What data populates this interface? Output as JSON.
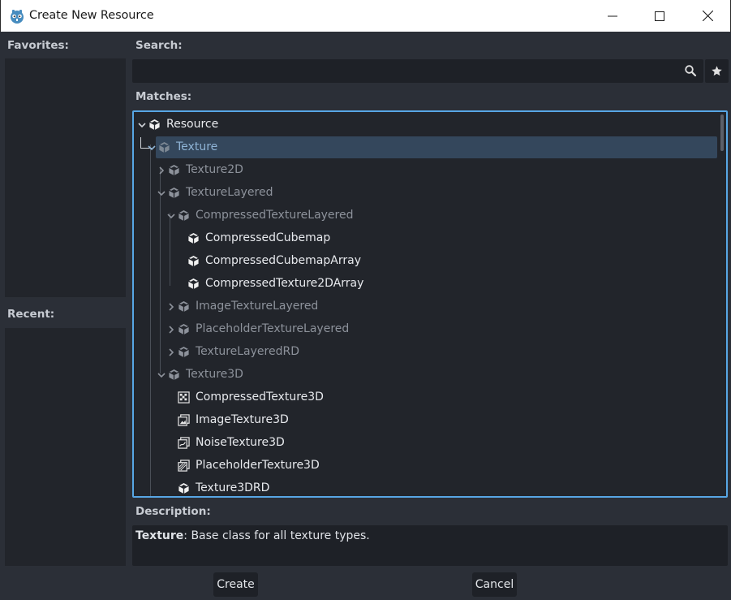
{
  "window": {
    "title": "Create New Resource"
  },
  "labels": {
    "favorites": "Favorites:",
    "recent": "Recent:",
    "search": "Search:",
    "matches": "Matches:",
    "description": "Description:"
  },
  "search": {
    "value": "",
    "placeholder": ""
  },
  "tree": [
    {
      "label": "Resource",
      "depth": 0,
      "expanded": true,
      "dim": false,
      "selected": false
    },
    {
      "label": "Texture",
      "depth": 1,
      "expanded": true,
      "dim": true,
      "selected": true
    },
    {
      "label": "Texture2D",
      "depth": 2,
      "expanded": false,
      "dim": true,
      "selected": false
    },
    {
      "label": "TextureLayered",
      "depth": 2,
      "expanded": true,
      "dim": true,
      "selected": false
    },
    {
      "label": "CompressedTextureLayered",
      "depth": 3,
      "expanded": true,
      "dim": true,
      "selected": false
    },
    {
      "label": "CompressedCubemap",
      "depth": 4,
      "expanded": null,
      "dim": false,
      "selected": false
    },
    {
      "label": "CompressedCubemapArray",
      "depth": 4,
      "expanded": null,
      "dim": false,
      "selected": false
    },
    {
      "label": "CompressedTexture2DArray",
      "depth": 4,
      "expanded": null,
      "dim": false,
      "selected": false
    },
    {
      "label": "ImageTextureLayered",
      "depth": 3,
      "expanded": false,
      "dim": true,
      "selected": false
    },
    {
      "label": "PlaceholderTextureLayered",
      "depth": 3,
      "expanded": false,
      "dim": true,
      "selected": false
    },
    {
      "label": "TextureLayeredRD",
      "depth": 3,
      "expanded": false,
      "dim": true,
      "selected": false
    },
    {
      "label": "Texture3D",
      "depth": 2,
      "expanded": true,
      "dim": true,
      "selected": false
    },
    {
      "label": "CompressedTexture3D",
      "depth": 3,
      "expanded": null,
      "dim": false,
      "selected": false,
      "icon": "compressed-texture-icon"
    },
    {
      "label": "ImageTexture3D",
      "depth": 3,
      "expanded": null,
      "dim": false,
      "selected": false,
      "icon": "image-texture-icon"
    },
    {
      "label": "NoiseTexture3D",
      "depth": 3,
      "expanded": null,
      "dim": false,
      "selected": false,
      "icon": "noise-texture-icon"
    },
    {
      "label": "PlaceholderTexture3D",
      "depth": 3,
      "expanded": null,
      "dim": false,
      "selected": false,
      "icon": "placeholder-texture-icon"
    },
    {
      "label": "Texture3DRD",
      "depth": 3,
      "expanded": null,
      "dim": false,
      "selected": false
    }
  ],
  "description": {
    "class_name": "Texture",
    "text": ": Base class for all texture types."
  },
  "buttons": {
    "create": "Create",
    "cancel": "Cancel"
  },
  "colors": {
    "accent": "#57a6e4",
    "selection": "#34475c",
    "background": "#2b2f37",
    "panel": "#22252b"
  }
}
